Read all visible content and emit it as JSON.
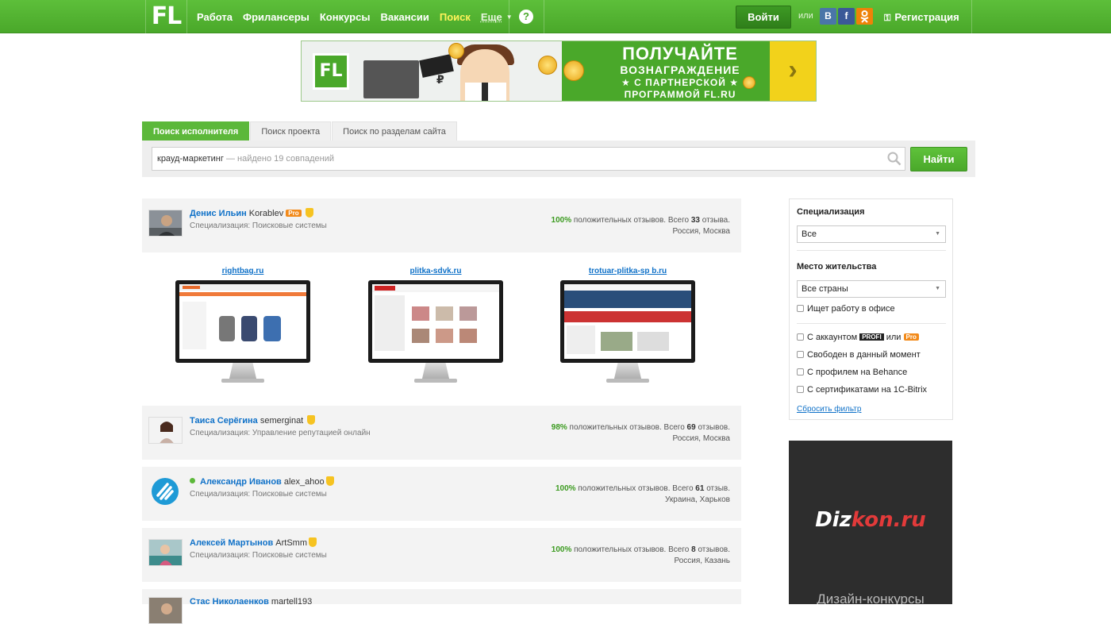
{
  "header": {
    "logo": "FL",
    "nav": [
      "Работа",
      "Фрилансеры",
      "Конкурсы",
      "Вакансии",
      "Поиск",
      "Еще"
    ],
    "active_nav": "Поиск",
    "help": "?",
    "login": "Войти",
    "or": "или",
    "social": [
      "B",
      "f",
      "ok"
    ],
    "register": "Регистрация",
    "colors": {
      "green": "#4aa82a",
      "active": "#fff35a"
    }
  },
  "banner": {
    "logo": "FL",
    "ruble": "₽",
    "line1": "ПОЛУЧАЙТЕ",
    "line2": "ВОЗНАГРАЖДЕНИЕ",
    "line3": "★ С ПАРТНЕРСКОЙ ★",
    "line4": "ПРОГРАММОЙ FL.RU"
  },
  "search": {
    "tabs": [
      "Поиск исполнителя",
      "Поиск проекта",
      "Поиск по разделам сайта"
    ],
    "query": "крауд-маркетинг",
    "found": " — найдено 19 совпадений",
    "button": "Найти"
  },
  "results": [
    {
      "name": "Денис Ильин",
      "login": "Korablev",
      "pro": "Pro",
      "online": false,
      "spec": "Специализация: Поисковые системы",
      "pct": "100%",
      "rev_text": " положительных отзывов. Всего ",
      "count": "33",
      "rev_tail": " отзыва.",
      "location": "Россия, Москва"
    },
    {
      "name": "Таиса Серёгина",
      "login": "semerginat",
      "pro": "",
      "online": false,
      "spec": "Специализация: Управление репутацией онлайн",
      "pct": "98%",
      "rev_text": " положительных отзывов. Всего ",
      "count": "69",
      "rev_tail": " отзывов.",
      "location": "Россия, Москва"
    },
    {
      "name": "Александр Иванов",
      "login": "alex_ahoo",
      "pro": "",
      "online": true,
      "spec": "Специализация: Поисковые системы",
      "pct": "100%",
      "rev_text": " положительных отзывов. Всего ",
      "count": "61",
      "rev_tail": " отзыв.",
      "location": "Украина, Харьков"
    },
    {
      "name": "Алексей Мартынов",
      "login": "ArtSmm",
      "pro": "",
      "online": false,
      "spec": "Специализация: Поисковые системы",
      "pct": "100%",
      "rev_text": " положительных отзывов. Всего ",
      "count": "8",
      "rev_tail": " отзывов.",
      "location": "Россия, Казань"
    },
    {
      "name": "Стас Николаенков",
      "login": "martell193",
      "pro": "",
      "online": false,
      "spec": "",
      "pct": "",
      "rev_text": "",
      "count": "",
      "rev_tail": "",
      "location": ""
    }
  ],
  "portfolio": [
    {
      "title": "rightbag.ru"
    },
    {
      "title": "plitka-sdvk.ru"
    },
    {
      "title": "trotuar-plitka-sp b.ru"
    }
  ],
  "filter": {
    "spec_label": "Специализация",
    "spec_value": "Все",
    "place_label": "Место жительства",
    "place_value": "Все страны",
    "office": "Ищет работу в офисе",
    "account_prefix": "С аккаунтом ",
    "profi": "PROFI",
    "or": " или ",
    "pro": "Pro",
    "free": "Свободен в данный момент",
    "behance": "С профилем на Behance",
    "bitrix": "С сертификатами на 1C-Bitrix",
    "reset": "Сбросить фильтр"
  },
  "ad": {
    "brand_a": "Diz",
    "brand_b": "kon.ru",
    "sub": "Дизайн-конкурсы"
  }
}
